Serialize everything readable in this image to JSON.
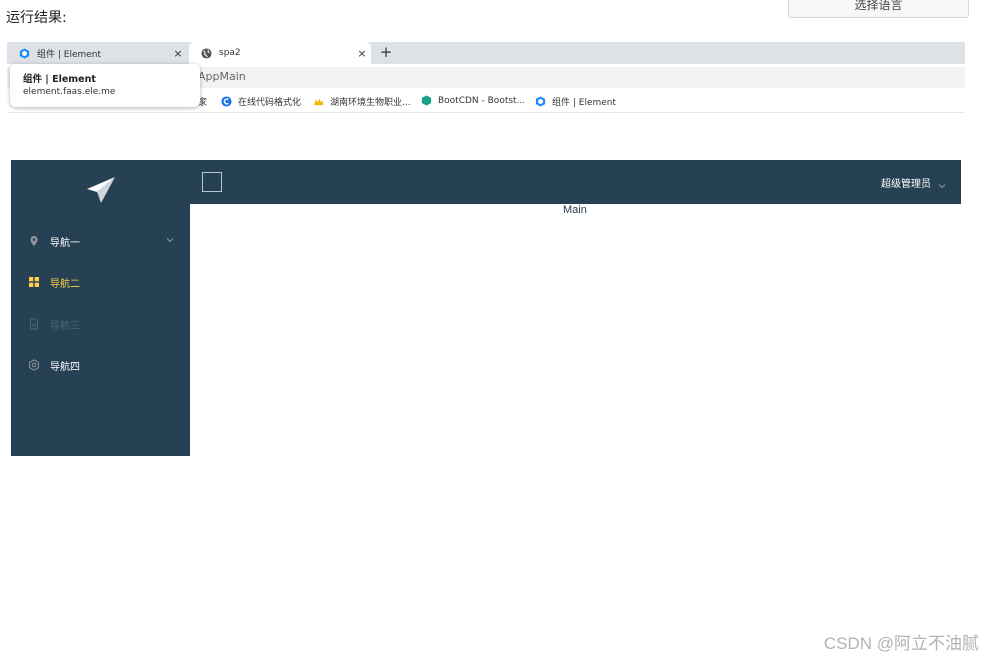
{
  "page": {
    "heading": "运行结果:",
    "language_button": "选择语言",
    "watermark": "CSDN @阿立不油腻"
  },
  "browser": {
    "tabs": [
      {
        "title": "组件 | Element",
        "icon": "element-icon",
        "close": "×"
      },
      {
        "title": "spa2",
        "icon": "globe-icon",
        "close": "×"
      }
    ],
    "new_tab": "+",
    "address": "AppMain",
    "tooltip": {
      "title": "组件 | Element",
      "url": "element.faas.ele.me"
    },
    "bookmarks": [
      {
        "label": "家",
        "icon": ""
      },
      {
        "label": "在线代码格式化",
        "icon": "blue-c-icon"
      },
      {
        "label": "湖南环境生物职业...",
        "icon": "yellow-leaf-icon"
      },
      {
        "label": "BootCDN - Bootst...",
        "icon": "green-hex-icon"
      },
      {
        "label": "组件 | Element",
        "icon": "element-icon"
      }
    ]
  },
  "app": {
    "sidebar_color": "#264153",
    "active_color": "#ffd04b",
    "nav": [
      {
        "label": "导航一",
        "icon": "location-icon",
        "state": "normal"
      },
      {
        "label": "导航二",
        "icon": "menu-grid-icon",
        "state": "active"
      },
      {
        "label": "导航三",
        "icon": "document-icon",
        "state": "disabled"
      },
      {
        "label": "导航四",
        "icon": "setting-icon",
        "state": "normal"
      }
    ],
    "header": {
      "user": "超级管理员"
    },
    "main": {
      "text": "Main"
    }
  }
}
